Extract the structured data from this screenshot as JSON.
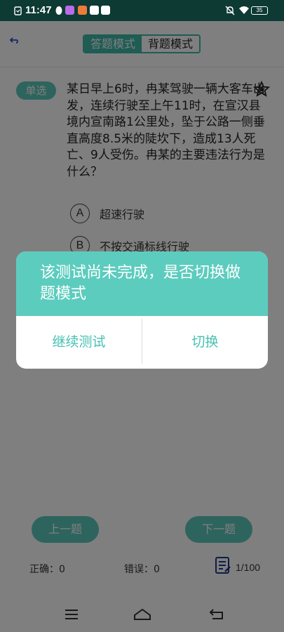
{
  "status_bar": {
    "time": "11:47",
    "battery": "35"
  },
  "header": {
    "back_icon": "back-arrow-icon",
    "tabs": [
      {
        "label": "答题模式",
        "active": true
      },
      {
        "label": "背题模式",
        "active": false
      }
    ]
  },
  "question": {
    "type_badge": "单选",
    "text": "某日早上6时，冉某驾驶一辆大客车出发，连续行驶至上午11时，在宣汉县境内宣南路1公里处，坠于公路一侧垂直高度8.5米的陡坎下，造成13人死亡、9人受伤。冉某的主要违法行为是什么？",
    "favorite_icon": "star-icon",
    "options": [
      {
        "letter": "A",
        "text": "超速行驶"
      },
      {
        "letter": "B",
        "text": "不按交通标线行驶"
      }
    ]
  },
  "nav": {
    "prev_label": "上一题",
    "next_label": "下一题"
  },
  "stats": {
    "correct": "正确：0",
    "wrong": "错误：0",
    "progress": "1/100",
    "sheet_icon": "answer-sheet-icon"
  },
  "dialog": {
    "message": "该测试尚未完成，是否切换做题模式",
    "continue_label": "继续测试",
    "switch_label": "切换"
  },
  "colors": {
    "accent": "#5cccbe",
    "status_bar": "#0d3a33"
  }
}
